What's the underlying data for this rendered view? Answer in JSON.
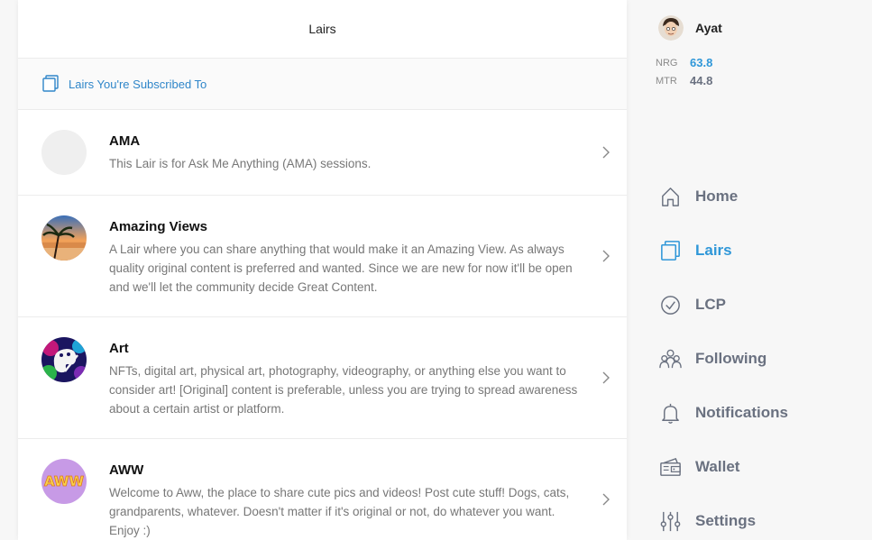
{
  "page": {
    "title": "Lairs"
  },
  "subscribed": {
    "label": "Lairs You're Subscribed To"
  },
  "lairs": [
    {
      "name": "AMA",
      "description": "This Lair is for Ask Me Anything (AMA) sessions."
    },
    {
      "name": "Amazing Views",
      "description": "A Lair where you can share anything that would make it an Amazing View. As always quality original content is preferred and wanted. Since we are new for now it'll be open and we'll let the community decide Great Content."
    },
    {
      "name": "Art",
      "description": "NFTs, digital art, physical art, photography, videography, or anything else you want to consider art! [Original] content is preferable, unless you are trying to spread awareness about a certain artist or platform."
    },
    {
      "name": "AWW",
      "description": "Welcome to Aww, the place to share cute pics and videos! Post cute stuff! Dogs, cats, grandparents, whatever. Doesn't matter if it's original or not, do whatever you want. Enjoy :)"
    }
  ],
  "user": {
    "name": "Ayat",
    "stats": [
      {
        "label": "NRG",
        "value": "63.8",
        "color": "#2f97d8"
      },
      {
        "label": "MTR",
        "value": "44.8",
        "color": "#6a7180"
      }
    ]
  },
  "nav": [
    {
      "label": "Home",
      "icon": "home-icon"
    },
    {
      "label": "Lairs",
      "icon": "lairs-icon",
      "active": true
    },
    {
      "label": "LCP",
      "icon": "check-circle-icon"
    },
    {
      "label": "Following",
      "icon": "people-icon"
    },
    {
      "label": "Notifications",
      "icon": "bell-icon"
    },
    {
      "label": "Wallet",
      "icon": "wallet-icon"
    },
    {
      "label": "Settings",
      "icon": "sliders-icon"
    }
  ],
  "colors": {
    "accent": "#2f97d8",
    "muted": "#6a7180",
    "link": "#2f86c9"
  }
}
